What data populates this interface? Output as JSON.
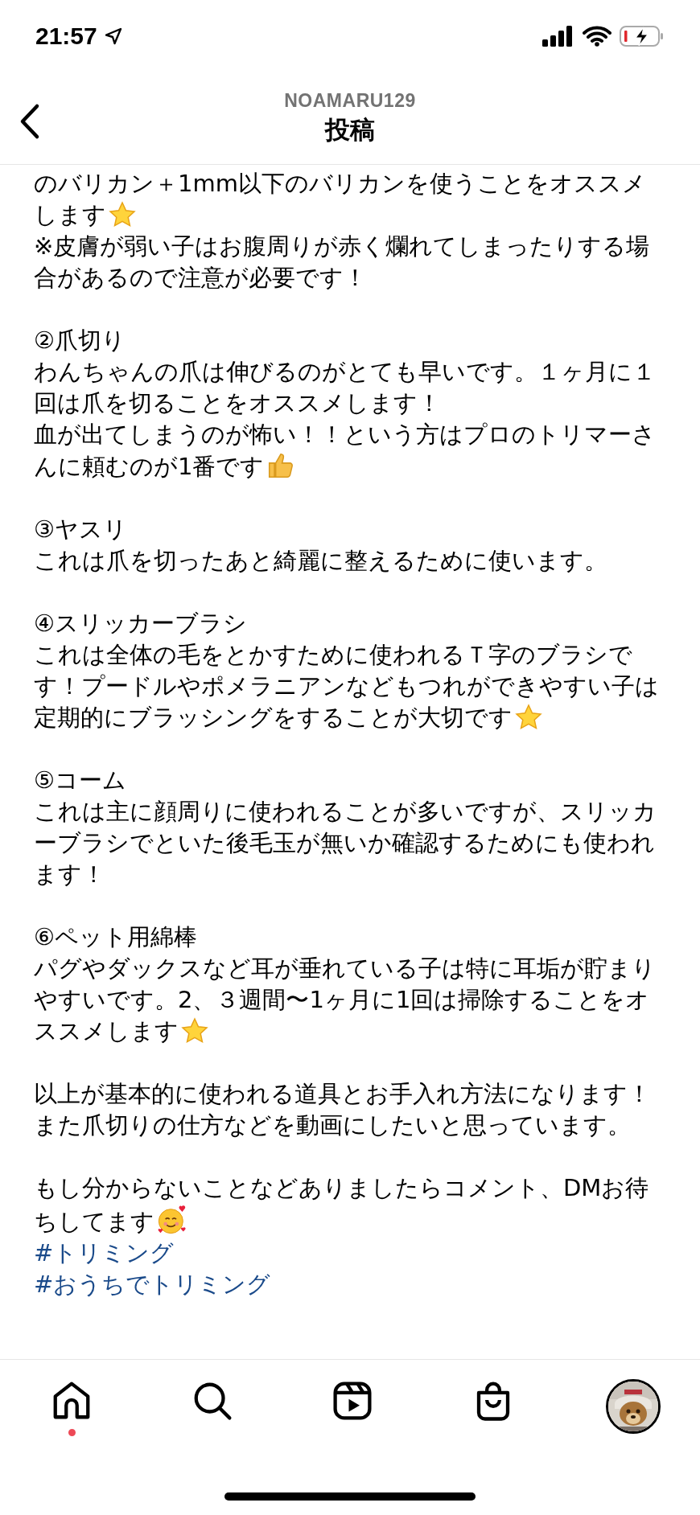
{
  "status_bar": {
    "time": "21:57"
  },
  "header": {
    "username": "NOAMARU129",
    "title": "投稿"
  },
  "caption": [
    {
      "lines": [
        {
          "text": "のバリカン＋1mm以下のバリカンを使うことをオススメ",
          "kind": "plain"
        },
        {
          "text": "します",
          "kind": "star"
        },
        {
          "text": "※皮膚が弱い子はお腹周りが赤く爛れてしまったりする場",
          "kind": "plain"
        },
        {
          "text": "合があるので注意が必要です！",
          "kind": "plain"
        }
      ]
    },
    {
      "lines": [
        {
          "text": "②爪切り",
          "kind": "plain"
        },
        {
          "text": "わんちゃんの爪は伸びるのがとても早いです。１ヶ月に１",
          "kind": "plain"
        },
        {
          "text": "回は爪を切ることをオススメします！",
          "kind": "plain"
        },
        {
          "text": "血が出てしまうのが怖い！！という方はプロのトリマーさ",
          "kind": "plain"
        },
        {
          "text": "んに頼むのが1番です",
          "kind": "thumbs_up"
        }
      ]
    },
    {
      "lines": [
        {
          "text": "③ヤスリ",
          "kind": "plain"
        },
        {
          "text": "これは爪を切ったあと綺麗に整えるために使います。",
          "kind": "plain"
        }
      ]
    },
    {
      "lines": [
        {
          "text": "④スリッカーブラシ",
          "kind": "plain"
        },
        {
          "text": "これは全体の毛をとかすために使われるＴ字のブラシで",
          "kind": "plain"
        },
        {
          "text": "す！プードルやポメラニアンなどもつれができやすい子は",
          "kind": "plain"
        },
        {
          "text": "定期的にブラッシングをすることが大切です",
          "kind": "star"
        }
      ]
    },
    {
      "lines": [
        {
          "text": "⑤コーム",
          "kind": "plain"
        },
        {
          "text": "これは主に顔周りに使われることが多いですが、スリッカ",
          "kind": "plain"
        },
        {
          "text": "ーブラシでといた後毛玉が無いか確認するためにも使われ",
          "kind": "plain"
        },
        {
          "text": "ます！",
          "kind": "plain"
        }
      ]
    },
    {
      "lines": [
        {
          "text": "⑥ペット用綿棒",
          "kind": "plain"
        },
        {
          "text": "パグやダックスなど耳が垂れている子は特に耳垢が貯まり",
          "kind": "plain"
        },
        {
          "text": "やすいです。2、３週間〜1ヶ月に1回は掃除することをオ",
          "kind": "plain"
        },
        {
          "text": "ススメします",
          "kind": "star"
        }
      ]
    },
    {
      "lines": [
        {
          "text": "以上が基本的に使われる道具とお手入れ方法になります！",
          "kind": "plain"
        },
        {
          "text": "また爪切りの仕方などを動画にしたいと思っています。",
          "kind": "plain"
        }
      ]
    },
    {
      "lines": [
        {
          "text": "もし分からないことなどありましたらコメント、DMお待",
          "kind": "plain"
        },
        {
          "text": "ちしてます",
          "kind": "smile"
        }
      ]
    }
  ],
  "hashtags": [
    "#トリミング",
    "#おうちでトリミング"
  ],
  "tab_bar": [
    {
      "kind": "home",
      "dot": true
    },
    {
      "kind": "search",
      "dot": false
    },
    {
      "kind": "reels",
      "dot": false
    },
    {
      "kind": "shop",
      "dot": false
    },
    {
      "kind": "profile",
      "dot": false
    }
  ]
}
